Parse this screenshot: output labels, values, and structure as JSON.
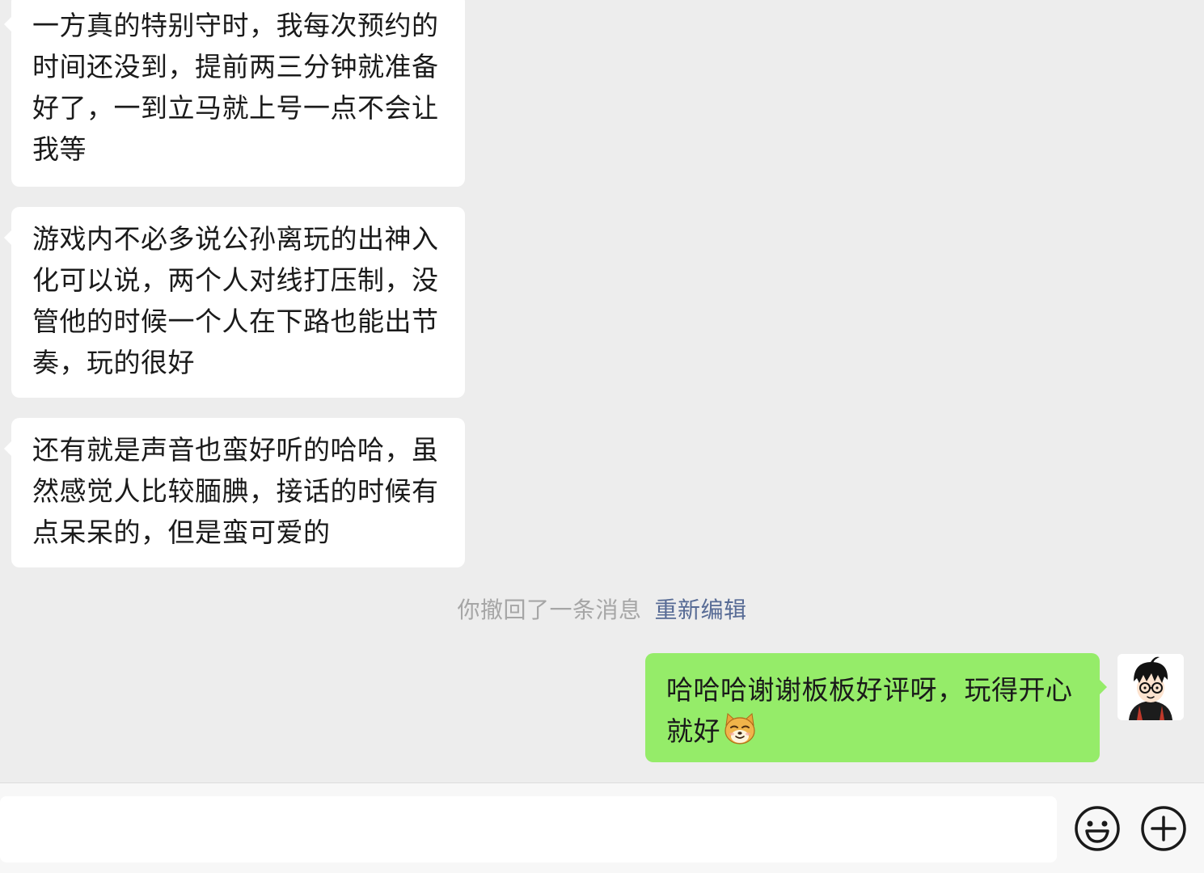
{
  "messages": [
    {
      "side": "left",
      "text": "一方真的特别守时，我每次预约的时间还没到，提前两三分钟就准备好了，一到立马就上号一点不会让我等"
    },
    {
      "side": "left",
      "text": "游戏内不必多说公孙离玩的出神入化可以说，两个人对线打压制，没管他的时候一个人在下路也能出节奏，玩的很好"
    },
    {
      "side": "left",
      "text": "还有就是声音也蛮好听的哈哈，虽然感觉人比较腼腆，接话的时候有点呆呆的，但是蛮可爱的"
    }
  ],
  "system": {
    "recall_text": "你撤回了一条消息",
    "reedit_link": "重新编辑"
  },
  "my_message": {
    "text": "哈哈哈谢谢板板好评呀，玩得开心就好",
    "emoji": "doge-emoji"
  },
  "avatar": {
    "icon": "cartoon-boy-glasses-avatar"
  },
  "input_bar": {
    "value": "",
    "placeholder": "",
    "emoji_button_icon": "smiley-face-icon",
    "more_button_icon": "plus-circle-icon"
  },
  "colors": {
    "chat_background": "#ededed",
    "received_bubble": "#ffffff",
    "sent_bubble": "#95ec69",
    "system_text": "#a6a6a6",
    "link_text": "#576b95"
  }
}
